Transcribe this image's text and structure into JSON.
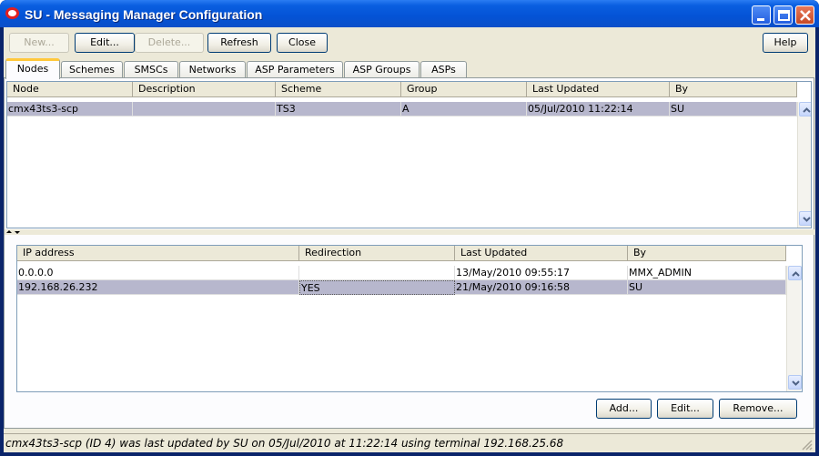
{
  "window": {
    "title": "SU - Messaging Manager Configuration",
    "controls": [
      "minimize-icon",
      "maximize-icon",
      "close-icon"
    ]
  },
  "toolbar": {
    "new_label": "New...",
    "edit_label": "Edit...",
    "delete_label": "Delete...",
    "refresh_label": "Refresh",
    "close_label": "Close",
    "help_label": "Help"
  },
  "tabs": [
    {
      "label": "Nodes",
      "active": true
    },
    {
      "label": "Schemes"
    },
    {
      "label": "SMSCs"
    },
    {
      "label": "Networks"
    },
    {
      "label": "ASP Parameters"
    },
    {
      "label": "ASP Groups"
    },
    {
      "label": "ASPs"
    }
  ],
  "nodes_table": {
    "columns": [
      "Node",
      "Description",
      "Scheme",
      "Group",
      "Last Updated",
      "By"
    ],
    "rows": [
      [
        "cmx43ts3-scp",
        "",
        "TS3",
        "A",
        "05/Jul/2010 11:22:14",
        "SU"
      ]
    ]
  },
  "ip_table": {
    "columns": [
      "IP address",
      "Redirection",
      "Last Updated",
      "By"
    ],
    "rows": [
      [
        "0.0.0.0",
        "",
        "13/May/2010 09:55:17",
        "MMX_ADMIN"
      ],
      [
        "192.168.26.232",
        "YES",
        "21/May/2010 09:16:58",
        "SU"
      ]
    ]
  },
  "ip_buttons": {
    "add_label": "Add...",
    "edit_label": "Edit...",
    "remove_label": "Remove..."
  },
  "status_text": "cmx43ts3-scp (ID 4) was last updated by SU on 05/Jul/2010 at 11:22:14 using terminal 192.168.25.68",
  "colors": {
    "titlebar": "#0453d6",
    "selected_row": "#b7b7cd",
    "active_tab_accent": "#ffc83c",
    "dialog_background": "#ece9d8"
  }
}
